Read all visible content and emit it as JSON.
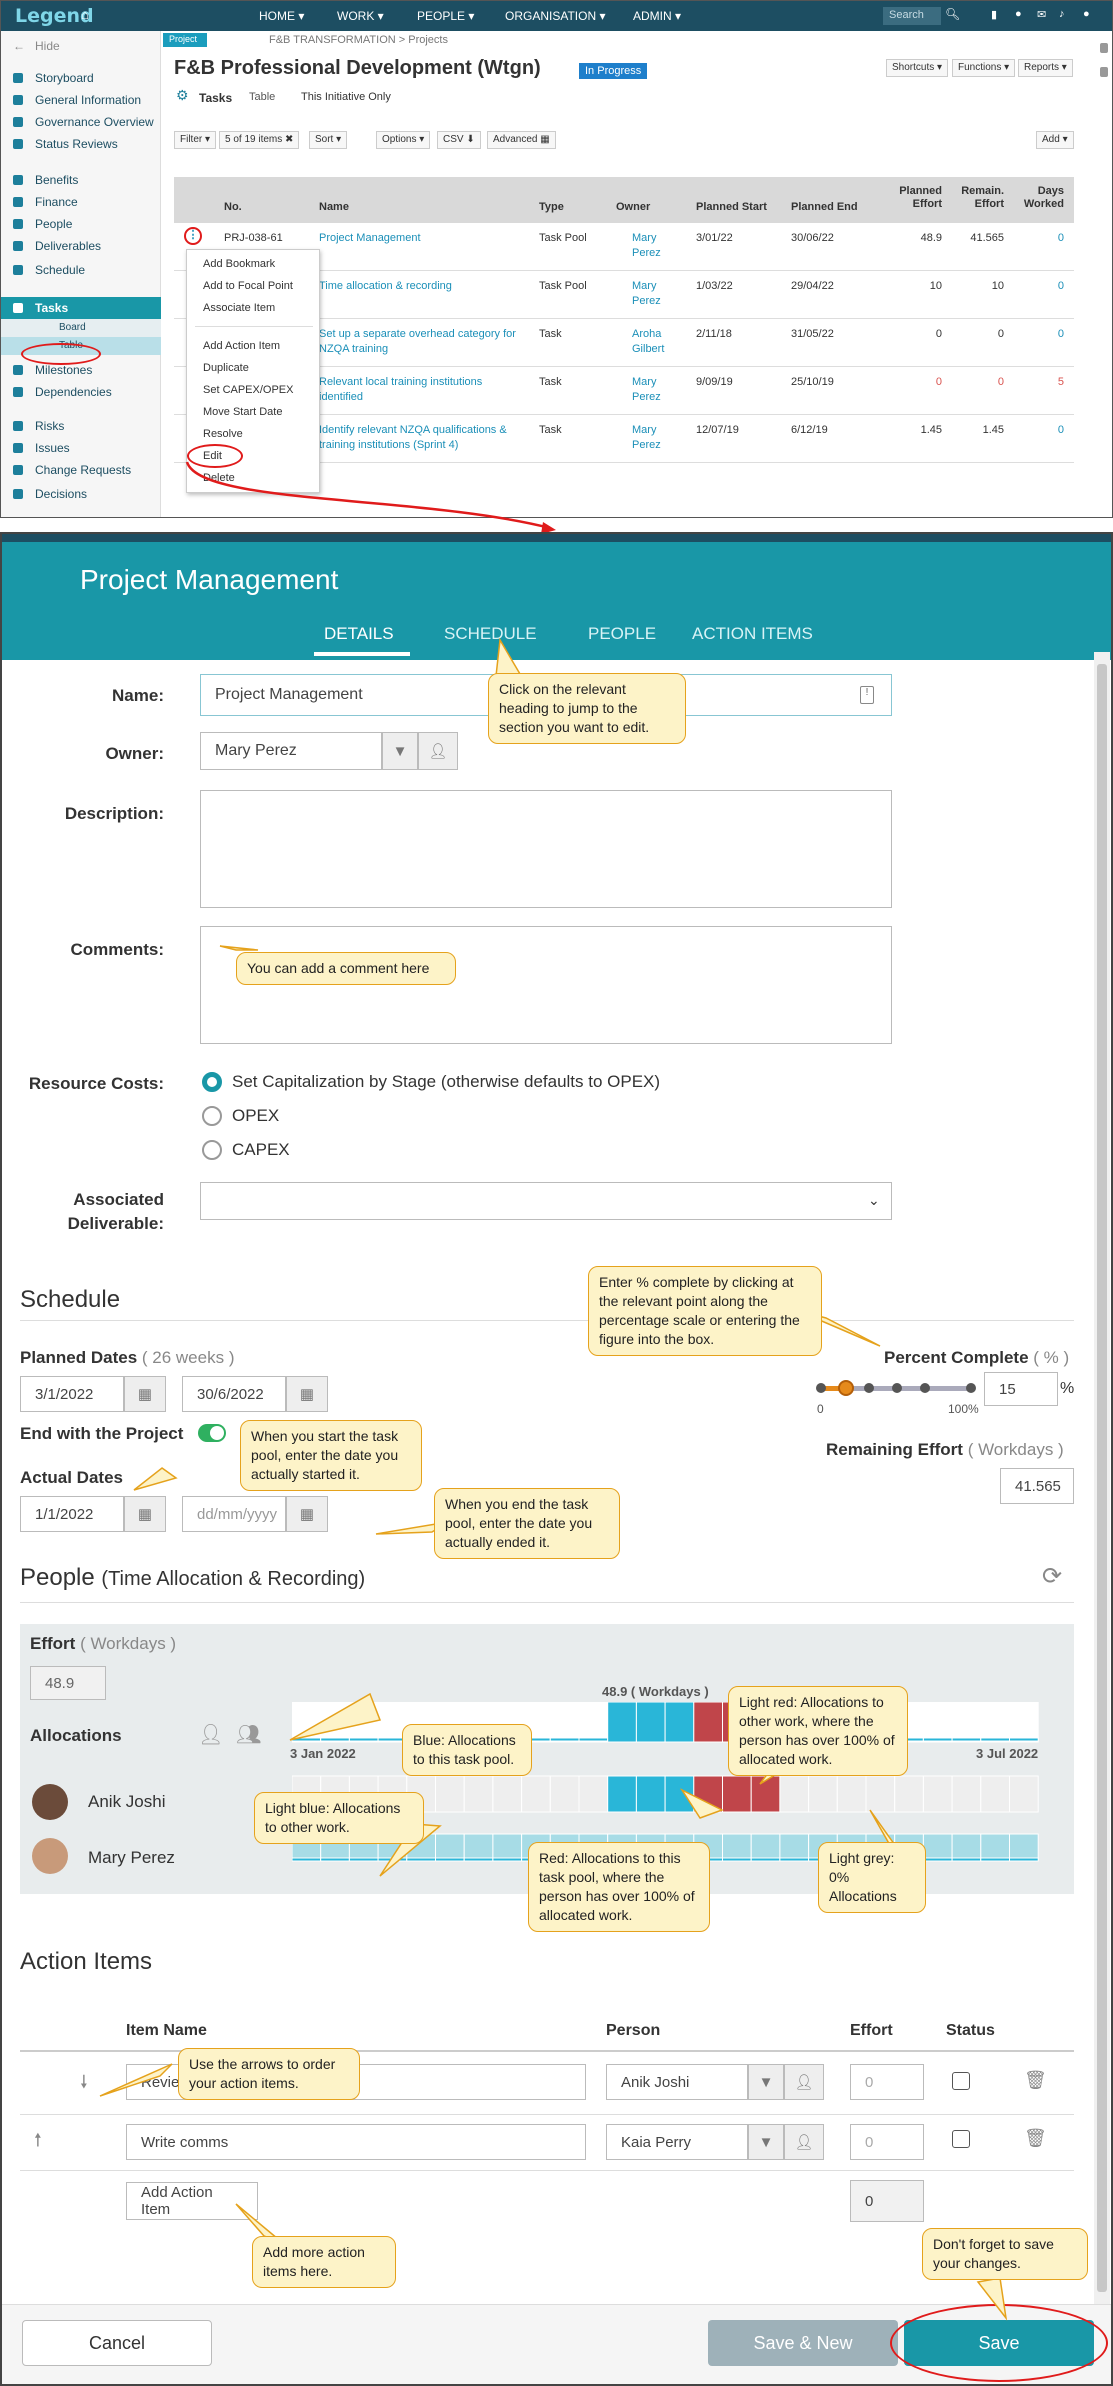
{
  "topbar": {
    "logo": "Legend",
    "menu": [
      "HOME ▾",
      "WORK ▾",
      "PEOPLE ▾",
      "ORGANISATION ▾",
      "ADMIN ▾"
    ],
    "search_placeholder": "Search"
  },
  "sidebar": {
    "hide": "Hide",
    "items": [
      "Storyboard",
      "General Information",
      "Governance Overview",
      "Status Reviews",
      "Benefits",
      "Finance",
      "People",
      "Deliverables",
      "Schedule",
      "Tasks",
      "Board",
      "Table",
      "Milestones",
      "Dependencies",
      "Risks",
      "Issues",
      "Change Requests",
      "Decisions"
    ]
  },
  "project": {
    "tag": "Project",
    "breadcrumb": "F&B TRANSFORMATION > Projects",
    "title": "F&B Professional Development (Wtgn)",
    "status": "In Progress",
    "view_tasks": "Tasks",
    "view_table": "Table",
    "view_scope": "This Initiative Only",
    "buttons": [
      "Shortcuts ▾",
      "Functions ▾",
      "Reports ▾"
    ],
    "toolbar": [
      "Filter ▾",
      "5 of 19 items ✖",
      "Sort ▾",
      "Options ▾",
      "CSV ⬇",
      "Advanced ▦",
      "Add ▾"
    ]
  },
  "grid": {
    "headers": [
      "No.",
      "Name",
      "Type",
      "Owner",
      "Planned Start",
      "Planned End",
      "Planned Effort",
      "Remain. Effort",
      "Days Worked"
    ],
    "rows": [
      {
        "no": "PRJ-038-61",
        "name": "Project Management",
        "type": "Task Pool",
        "owner": "Mary Perez",
        "start": "3/01/22",
        "end": "30/06/22",
        "planned": "48.9",
        "remain": "41.565",
        "days": "0"
      },
      {
        "no": "",
        "name": "Time allocation & recording",
        "type": "Task Pool",
        "owner": "Mary Perez",
        "start": "1/03/22",
        "end": "29/04/22",
        "planned": "10",
        "remain": "10",
        "days": "0"
      },
      {
        "no": "",
        "name": "Set up a separate overhead category for NZQA training",
        "type": "Task",
        "owner": "Aroha Gilbert",
        "start": "2/11/18",
        "end": "31/05/22",
        "planned": "0",
        "remain": "0",
        "days": "0"
      },
      {
        "no": "",
        "name": "Relevant local training institutions identified",
        "type": "Task",
        "owner": "Mary Perez",
        "start": "9/09/19",
        "end": "25/10/19",
        "planned": "0",
        "remain": "0",
        "days": "5"
      },
      {
        "no": "",
        "name": "Identify relevant NZQA qualifications & training institutions (Sprint 4)",
        "type": "Task",
        "owner": "Mary Perez",
        "start": "12/07/19",
        "end": "6/12/19",
        "planned": "1.45",
        "remain": "1.45",
        "days": "0"
      }
    ]
  },
  "context_menu": [
    "Add Bookmark",
    "Add to Focal Point",
    "Associate Item",
    "Add Action Item",
    "Duplicate",
    "Set CAPEX/OPEX",
    "Move Start Date",
    "Resolve",
    "Edit",
    "Delete"
  ],
  "modal": {
    "title": "Project Management",
    "tabs": [
      "DETAILS",
      "SCHEDULE",
      "PEOPLE",
      "ACTION ITEMS"
    ],
    "labels": {
      "name": "Name:",
      "owner": "Owner:",
      "description": "Description:",
      "comments": "Comments:",
      "resource_costs": "Resource Costs:",
      "assoc1": "Associated",
      "assoc2": "Deliverable:"
    },
    "name_value": "Project Management",
    "owner_value": "Mary Perez",
    "resource_options": [
      "Set Capitalization by Stage (otherwise defaults to OPEX)",
      "OPEX",
      "CAPEX"
    ],
    "schedule": {
      "heading": "Schedule",
      "planned_dates": "Planned Dates",
      "planned_weeks": "( 26 weeks )",
      "planned_start": "3/1/2022",
      "planned_end": "30/6/2022",
      "end_with_project": "End with the Project",
      "actual_dates": "Actual Dates",
      "actual_start": "1/1/2022",
      "actual_end_placeholder": "dd/mm/yyyy",
      "percent_label": "Percent Complete",
      "percent_unit": "( % )",
      "percent_value": "15",
      "percent_sign": "%",
      "scale_min": "0",
      "scale_max": "100%",
      "remaining_label": "Remaining Effort",
      "remaining_unit": "( Workdays )",
      "remaining_value": "41.565"
    },
    "people": {
      "heading": "People",
      "heading_sub": "(Time Allocation & Recording)",
      "effort_label": "Effort",
      "effort_unit": "( Workdays )",
      "effort_value": "48.9",
      "allocations": "Allocations",
      "chart_total": "48.9 ( Workdays )",
      "date_start": "3 Jan 2022",
      "date_end": "3 Jul 2022",
      "persons": [
        "Anik Joshi",
        "Mary Perez"
      ]
    },
    "action_items": {
      "heading": "Action Items",
      "headers": [
        "Item Name",
        "Person",
        "Effort",
        "Status"
      ],
      "rows": [
        {
          "name": "Review",
          "person": "Anik Joshi",
          "effort": "0"
        },
        {
          "name": "Write comms",
          "person": "Kaia Perry",
          "effort": "0"
        }
      ],
      "add_button": "Add Action Item",
      "total": "0"
    },
    "footer": {
      "cancel": "Cancel",
      "save_new": "Save & New",
      "save": "Save"
    }
  },
  "callouts": {
    "tabs": "Click on the relevant heading to jump to the section you want to edit.",
    "comment": "You can add a comment here",
    "percent": "Enter % complete by clicking at the relevant point along the percentage scale or entering the figure into the box.",
    "start": "When you start the task pool, enter the date you actually started it.",
    "end": "When you end the task pool, enter the date you actually ended it.",
    "blue": "Blue: Allocations to this task pool.",
    "lightblue": "Light blue: Allocations to other work.",
    "red": "Red: Allocations to this task pool, where the person has over 100% of allocated work.",
    "lightred": "Light red: Allocations to other work, where the person has over 100% of allocated work.",
    "grey": "Light grey: 0% Allocations",
    "arrows": "Use the arrows to order your action items.",
    "add": "Add more action items here.",
    "save": "Don't forget to save your changes."
  },
  "colors": {
    "teal": "#1997a7",
    "navy": "#1d4e62",
    "blue": "#29b6d8",
    "lightblue": "#a7dce6",
    "red": "#c0454a",
    "lightred": "#d98c8c",
    "grey": "#eeeeee",
    "callout": "#fdf3c8"
  }
}
